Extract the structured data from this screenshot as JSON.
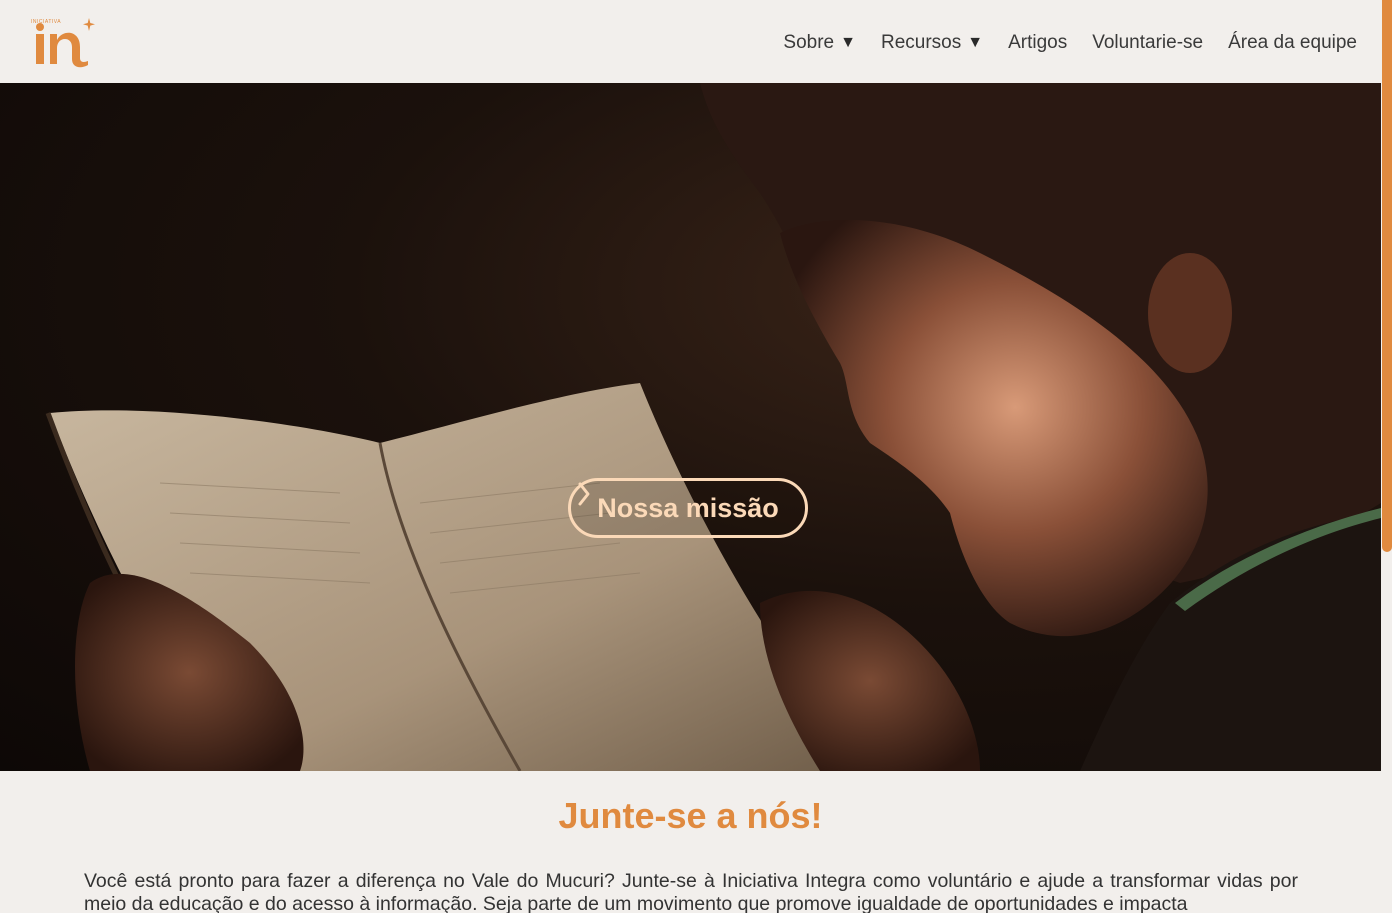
{
  "brand": {
    "logo_text": "in",
    "logo_tagline": "INICIATIVA",
    "accent": "#e08a3f"
  },
  "nav": {
    "items": [
      {
        "label": "Sobre",
        "caret": "▼"
      },
      {
        "label": "Recursos",
        "caret": "▼"
      },
      {
        "label": "Artigos"
      },
      {
        "label": "Voluntarie-se"
      },
      {
        "label": "Área da equipe"
      }
    ]
  },
  "hero": {
    "button_label": "Nossa missão"
  },
  "join": {
    "title": "Junte-se a nós!",
    "text": "Você está pronto para fazer a diferença no Vale do Mucuri? Junte-se à Iniciativa Integra como voluntário e ajude a transformar vidas por meio da educação e do acesso à informação. Seja parte de um movimento que promove igualdade de oportunidades e impacta"
  },
  "colors": {
    "background": "#f2efec",
    "button_outline": "#fbd9b8",
    "title": "#e08a3f"
  }
}
